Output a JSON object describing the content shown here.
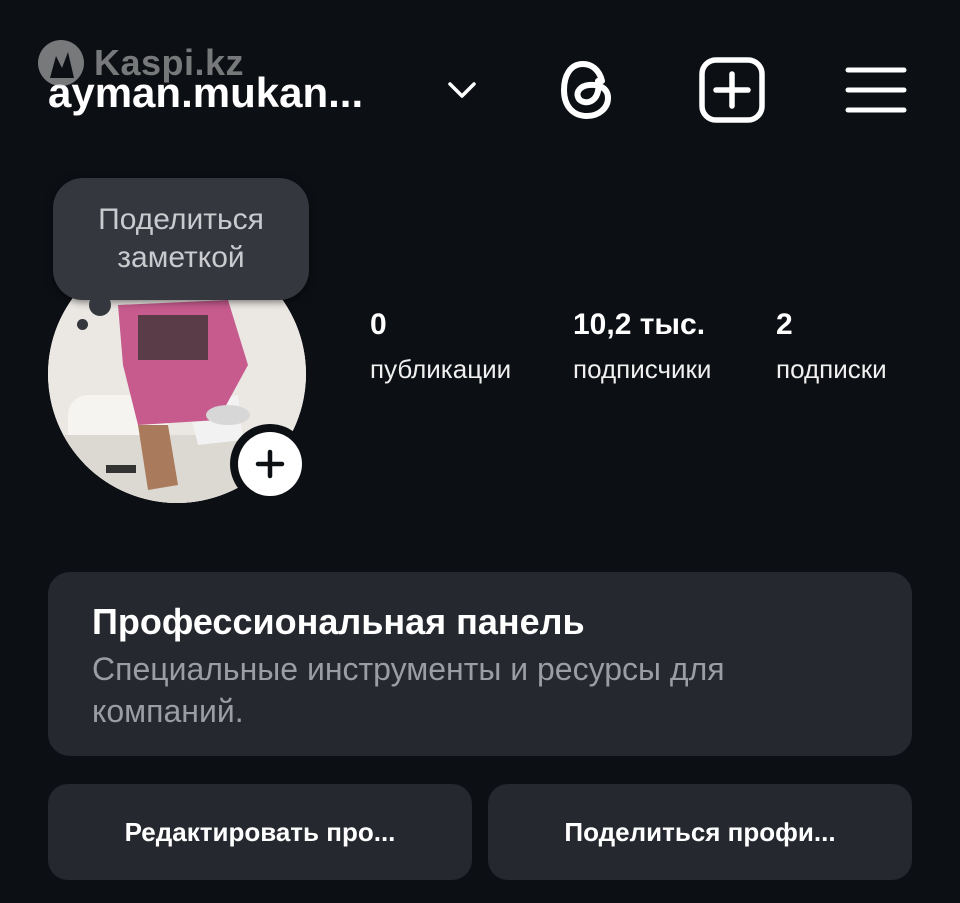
{
  "watermark": {
    "text": "Kaspi.kz"
  },
  "header": {
    "username": "ayman.mukan...",
    "icons": [
      "chevron-down-icon",
      "threads-icon",
      "add-post-icon",
      "menu-icon"
    ]
  },
  "note": {
    "text_line1": "Поделиться",
    "text_line2": "заметкой"
  },
  "stats": {
    "posts": {
      "value": "0",
      "label": "публикации"
    },
    "followers": {
      "value": "10,2 тыс.",
      "label": "подписчики"
    },
    "following": {
      "value": "2",
      "label": "подписки"
    }
  },
  "pro_panel": {
    "title": "Профессиональная панель",
    "subtitle": "Специальные инструменты и ресурсы для компаний."
  },
  "buttons": {
    "edit_profile": "Редактировать про...",
    "share_profile": "Поделиться профи..."
  },
  "colors": {
    "background": "#0c0f14",
    "card": "#25282e",
    "note_bubble": "#34373d",
    "muted_text": "#9a9da3",
    "avatar_shirt": "#c75b8e"
  }
}
